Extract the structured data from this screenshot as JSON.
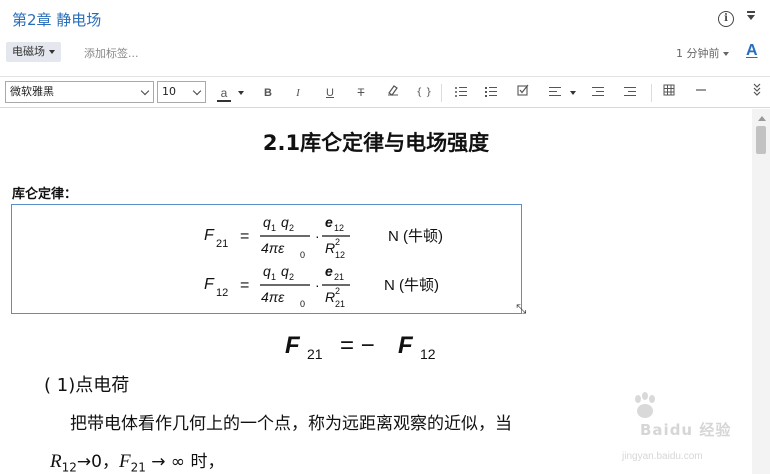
{
  "titlebar": {
    "title": "第2章 静电场"
  },
  "tagbar": {
    "notebook": "电磁场",
    "add_tag_placeholder": "添加标签...",
    "modified": "1 分钟前",
    "font_button": "A"
  },
  "toolbar": {
    "font_family": "微软雅黑",
    "font_size": "10",
    "color_label": "a",
    "bold": "B",
    "italic": "I",
    "underline": "U",
    "strike": "T",
    "code": "{ }"
  },
  "document": {
    "heading": "2.1库仑定律与电场强度",
    "subhead": "库仑定律：",
    "formula1_lhs": "F",
    "formula1_sub": "21",
    "formula2_sub": "12",
    "unit": "N (牛顿)",
    "q1": "q",
    "q1_sub": "1",
    "q2_sub": "2",
    "denom": "4πε",
    "denom_sub": "0",
    "e": "e",
    "R": "R",
    "big_formula": "F₂₁ = − F₁₂",
    "point_charge_heading": "( 1)点电荷",
    "body_text": "把带电体看作几何上的一个点，称为远距离观察的近似，当",
    "math_line_r": "R",
    "math_line_r_sub": "12",
    "math_line_rest1": "→0，",
    "math_line_f": "F",
    "math_line_f_sub": "21",
    "math_line_rest2": " → ∞ 时，"
  },
  "watermark": {
    "text": "Baidu 经验",
    "url": "jingyan.baidu.com"
  },
  "colors": {
    "accent": "#2a6ebb",
    "box_border": "#5b8fc9"
  }
}
